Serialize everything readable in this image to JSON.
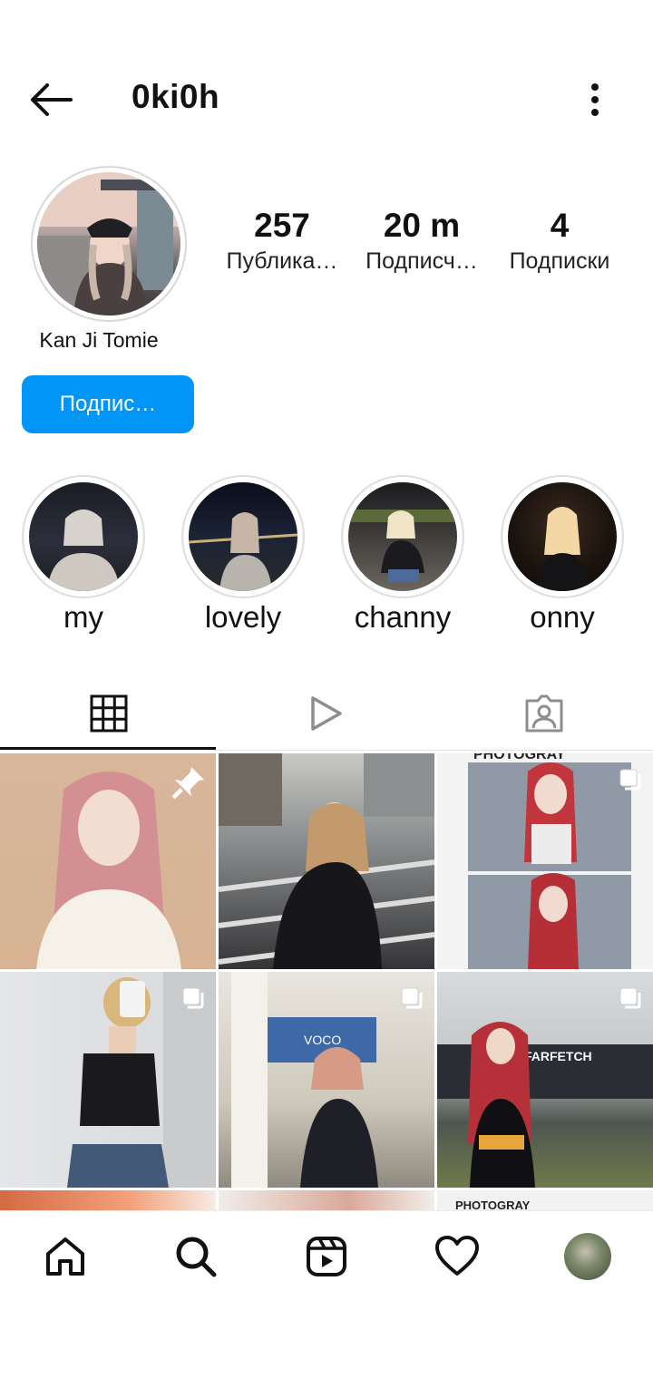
{
  "header": {
    "username": "0ki0h",
    "back_icon": "arrow-left-icon",
    "more_icon": "more-vertical-icon"
  },
  "profile": {
    "display_name": "Kan Ji Tomie",
    "stats": [
      {
        "value": "257",
        "label": "Публика…"
      },
      {
        "value": "20 m",
        "label": "Подписч…"
      },
      {
        "value": "4",
        "label": "Подписки"
      }
    ],
    "follow_button": "Подпис…"
  },
  "highlights": [
    {
      "label": "my"
    },
    {
      "label": "lovely"
    },
    {
      "label": "channy"
    },
    {
      "label": "onny"
    }
  ],
  "tabs": [
    {
      "icon": "grid-icon",
      "active": true
    },
    {
      "icon": "reels-play-icon",
      "active": false
    },
    {
      "icon": "tagged-person-icon",
      "active": false
    }
  ],
  "grid": {
    "photo_texts": [
      "PHOTOGRAY",
      "FARFETCH",
      "PHOTOGRAY",
      "VOCO"
    ],
    "badges": [
      "pin-icon",
      "",
      "multiple-icon",
      "multiple-icon",
      "multiple-icon",
      "multiple-icon"
    ]
  },
  "bottom_nav": [
    {
      "icon": "home-icon"
    },
    {
      "icon": "search-icon"
    },
    {
      "icon": "reels-icon"
    },
    {
      "icon": "heart-icon"
    },
    {
      "icon": "profile-avatar"
    }
  ],
  "colors": {
    "accent": "#0095f6",
    "text": "#111111",
    "tab_inactive": "#8e8e8e"
  }
}
